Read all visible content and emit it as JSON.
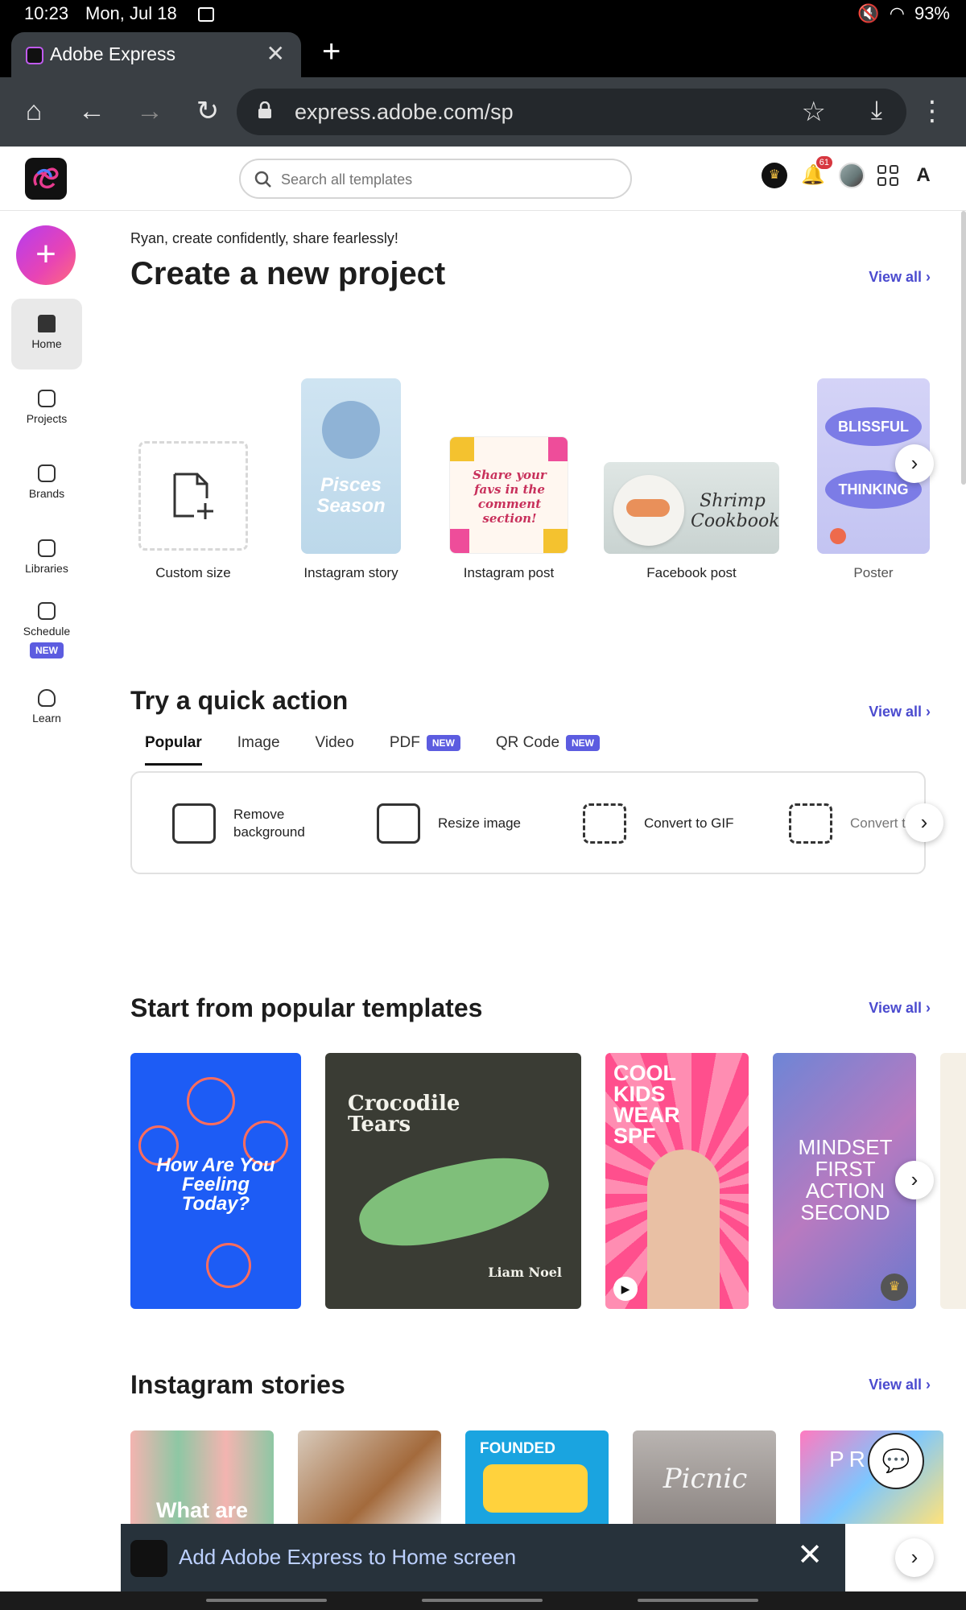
{
  "status_bar": {
    "time": "10:23",
    "date": "Mon, Jul 18",
    "battery": "93%"
  },
  "browser": {
    "tab_title": "Adobe Express",
    "url": "express.adobe.com/sp"
  },
  "header": {
    "search_placeholder": "Search all templates",
    "notification_count": "61"
  },
  "rail": {
    "home": "Home",
    "projects": "Projects",
    "brands": "Brands",
    "libraries": "Libraries",
    "schedule": "Schedule",
    "schedule_badge": "NEW",
    "learn": "Learn"
  },
  "main": {
    "greeting": "Ryan, create confidently, share fearlessly!",
    "create_title": "Create a new project",
    "view_all": "View all",
    "project_types": [
      "Custom size",
      "Instagram story",
      "Instagram post",
      "Facebook post",
      "Poster"
    ],
    "tiles": {
      "story_text": "Pisces Season",
      "post_text": "Share your favs in the comment section!",
      "fb_text": "Shrimp Cookbook",
      "poster_text1": "BLISSFUL",
      "poster_text2": "THINKING"
    },
    "quick_title": "Try a quick action",
    "quick_tabs": [
      "Popular",
      "Image",
      "Video",
      "PDF",
      "QR Code"
    ],
    "new_badge": "NEW",
    "quick_actions": [
      "Remove background",
      "Resize image",
      "Convert to GIF",
      "Convert to"
    ],
    "templates_title": "Start from popular templates",
    "templates": {
      "t1": "How Are You Feeling Today?",
      "t2": "Crocodile Tears",
      "t2_author": "Liam Noel",
      "t3": "COOL KIDS WEAR SPF",
      "t4": "MINDSET FIRST ACTION SECOND"
    },
    "stories_title": "Instagram stories",
    "stories": {
      "s1": "What are",
      "s3": "FOUNDED",
      "s4": "Picnic",
      "s5": "PR"
    }
  },
  "install_bar": {
    "text": "Add Adobe Express to Home screen"
  },
  "colors": {
    "accent": "#4b4bcf",
    "badge": "#5c5ce0",
    "create": "#b53cf0"
  }
}
